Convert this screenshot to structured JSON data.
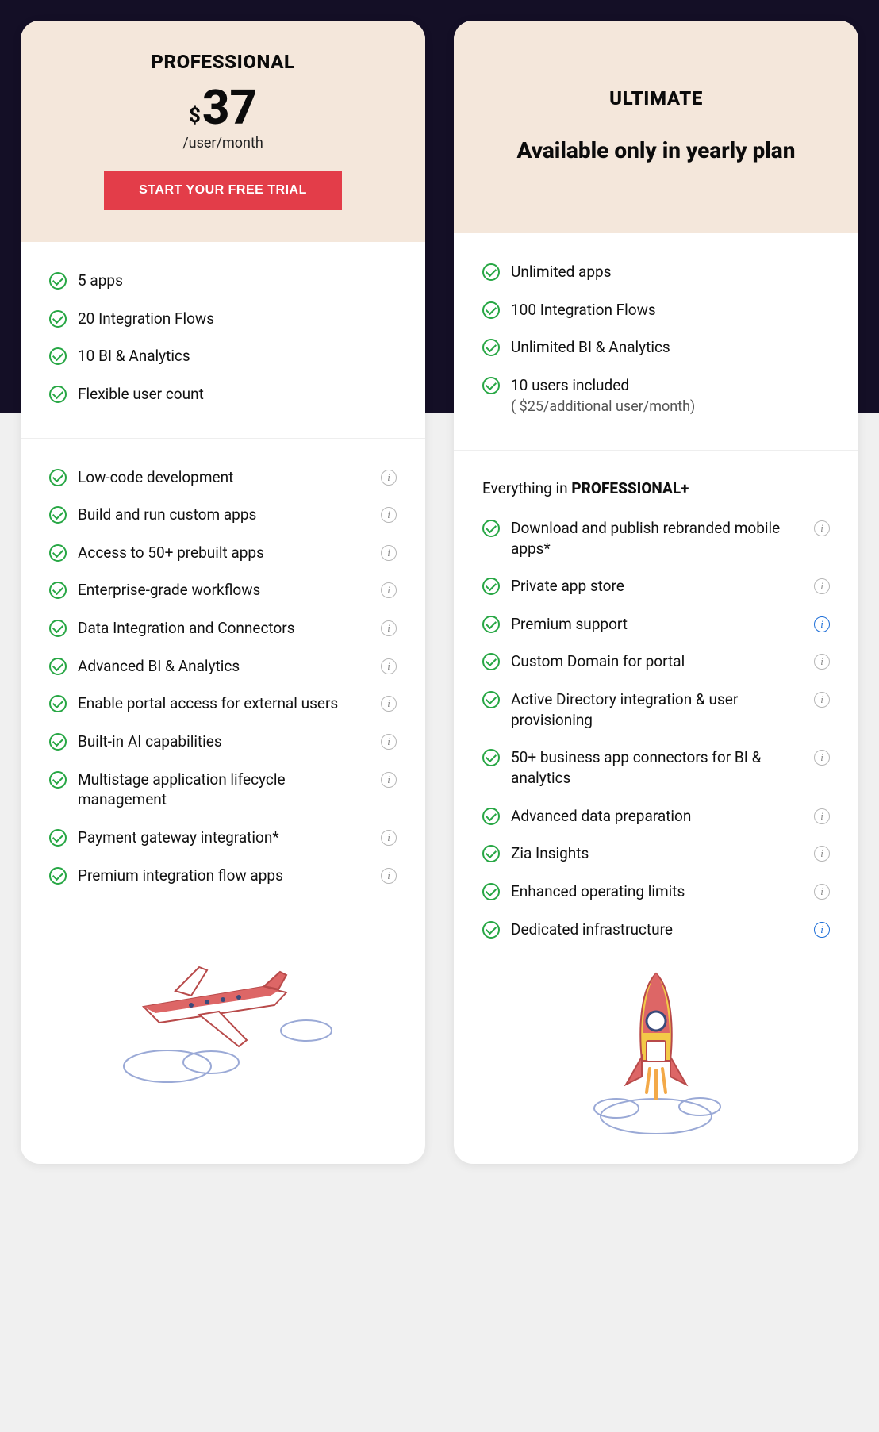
{
  "plans": [
    {
      "name": "PROFESSIONAL",
      "currency": "$",
      "price": "37",
      "per": "/user/month",
      "cta": "START YOUR FREE TRIAL",
      "topFeatures": [
        {
          "text": "5 apps"
        },
        {
          "text": "20 Integration Flows"
        },
        {
          "text": "10 BI & Analytics"
        },
        {
          "text": "Flexible user count"
        }
      ],
      "features": [
        {
          "text": "Low-code development",
          "info": true
        },
        {
          "text": "Build and run custom apps",
          "info": true
        },
        {
          "text": "Access to 50+ prebuilt apps",
          "info": true
        },
        {
          "text": "Enterprise-grade workflows",
          "info": true
        },
        {
          "text": "Data Integration and Connectors",
          "info": true
        },
        {
          "text": "Advanced BI & Analytics",
          "info": true
        },
        {
          "text": "Enable portal access for external users",
          "info": true
        },
        {
          "text": "Built-in AI capabilities",
          "info": true
        },
        {
          "text": "Multistage application lifecycle management",
          "info": true
        },
        {
          "text": "Payment gateway integration*",
          "info": true
        },
        {
          "text": "Premium integration flow apps",
          "info": true
        }
      ]
    },
    {
      "name": "ULTIMATE",
      "yearlyOnly": "Available only in yearly plan",
      "topFeatures": [
        {
          "text": "Unlimited apps"
        },
        {
          "text": "100 Integration Flows"
        },
        {
          "text": "Unlimited BI & Analytics"
        },
        {
          "text": "10 users included",
          "sub": "( $25/additional user/month)"
        }
      ],
      "everythingPrefix": "Everything in ",
      "everythingPlan": "PROFESSIONAL+",
      "features": [
        {
          "text": "Download and publish rebranded mobile apps*",
          "info": true
        },
        {
          "text": "Private app store",
          "info": true
        },
        {
          "text": "Premium support",
          "info": true,
          "blue": true
        },
        {
          "text": "Custom Domain for portal",
          "info": true
        },
        {
          "text": "Active Directory integration & user provisioning",
          "info": true
        },
        {
          "text": "50+ business app connectors for BI & analytics",
          "info": true
        },
        {
          "text": "Advanced data preparation",
          "info": true
        },
        {
          "text": "Zia Insights",
          "info": true
        },
        {
          "text": "Enhanced operating limits",
          "info": true
        },
        {
          "text": "Dedicated infrastructure",
          "info": true,
          "blue": true
        }
      ]
    }
  ]
}
